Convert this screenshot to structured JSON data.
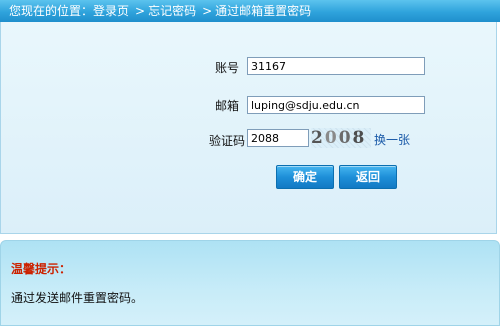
{
  "breadcrumb": {
    "prefix": "您现在的位置：",
    "items": [
      "登录页",
      "忘记密码",
      "通过邮箱重置密码"
    ],
    "separator": ">"
  },
  "form": {
    "account_label": "账号",
    "account_value": "31167",
    "email_label": "邮箱",
    "email_value": "luping@sdju.edu.cn",
    "captcha_label": "验证码",
    "captcha_value": "2088",
    "captcha_image_text": [
      "2",
      "0",
      "0",
      "8"
    ],
    "refresh_label": "换一张",
    "confirm_label": "确定",
    "back_label": "返回"
  },
  "tip": {
    "title": "温馨提示：",
    "text": "通过发送邮件重置密码。"
  },
  "colors": {
    "header_blue": "#2fa3dc",
    "tip_title_red": "#cc2200",
    "link_blue": "#1a5aa8",
    "button_blue": "#1e8fd8"
  }
}
